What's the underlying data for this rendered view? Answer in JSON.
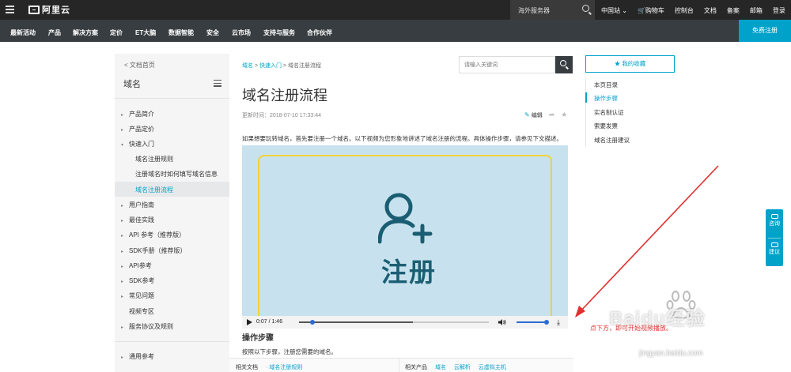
{
  "header": {
    "logo_text": "阿里云",
    "search_placeholder": "海外服务器",
    "region": "中国站",
    "links": [
      "购物车",
      "控制台",
      "文档",
      "备案",
      "邮箱",
      "登录"
    ]
  },
  "nav": {
    "items": [
      "最新活动",
      "产品",
      "解决方案",
      "定价",
      "ET大脑",
      "数据智能",
      "安全",
      "云市场",
      "支持与服务",
      "合作伙伴"
    ],
    "register": "免费注册"
  },
  "sidebar": {
    "back": "< 文档首页",
    "title": "域名",
    "items": [
      {
        "label": "产品简介",
        "caret": "▸"
      },
      {
        "label": "产品定价",
        "caret": "▸"
      },
      {
        "label": "快速入门",
        "caret": "▾"
      },
      {
        "label": "用户指南",
        "caret": "▸"
      },
      {
        "label": "最佳实践",
        "caret": "▸"
      },
      {
        "label": "API 参考（推荐版）",
        "caret": "▸"
      },
      {
        "label": "SDK手册（推荐版）",
        "caret": "▸"
      },
      {
        "label": "API参考",
        "caret": "▸"
      },
      {
        "label": "SDK参考",
        "caret": "▸"
      },
      {
        "label": "常见问题",
        "caret": "▸"
      },
      {
        "label": "视频专区",
        "caret": ""
      },
      {
        "label": "服务协议及规则",
        "caret": "▸"
      },
      {
        "label": "通用参考",
        "caret": "▸"
      }
    ],
    "subitems": [
      "域名注册规则",
      "注册域名时如何填写域名信息",
      "域名注册流程"
    ]
  },
  "breadcrumb": {
    "a": "域名",
    "sep1": " > ",
    "b": "快速入门",
    "sep2": " > ",
    "c": "域名注册流程"
  },
  "search": {
    "placeholder": "请输入关键词"
  },
  "article": {
    "title": "域名注册流程",
    "updated": "更新时间：2018-07-10 17:33:44",
    "edit": "编辑",
    "intro": "如果想要玩转域名，首先要注册一个域名。以下视频为您形象地讲述了域名注册的流程。具体操作步骤，请参见下文描述。",
    "video_label": "注册",
    "video_time": "0:07 / 1:46",
    "video_progress": 0.07,
    "video_buffered": 0.6,
    "volume": 1.0,
    "section_title": "操作步骤",
    "section_text": "按照以下步骤，注册您需要的域名。"
  },
  "related": {
    "docs_label": "相关文档",
    "docs": [
      "域名注册规则"
    ],
    "products_label": "相关产品",
    "products": [
      "域名",
      "云解析",
      "云虚拟主机"
    ]
  },
  "right": {
    "fav": "★ 我的收藏",
    "toc_title": "本页目录",
    "toc": [
      "操作步骤",
      "实名制认证",
      "索要发票",
      "域名注册建议"
    ]
  },
  "float": {
    "consult": "咨询",
    "suggest": "建议"
  },
  "annotation": {
    "caption": "点下方，即可开始视频播放。",
    "watermark": "Baidu经验",
    "watermark_url": "jingyan.baidu.com"
  },
  "colors": {
    "accent": "#00a2ca",
    "topbar": "#262626",
    "navbar": "#373d41",
    "video_bg": "#c7e2ee",
    "video_ink": "#1b5e73",
    "arrow": "#e03030"
  }
}
